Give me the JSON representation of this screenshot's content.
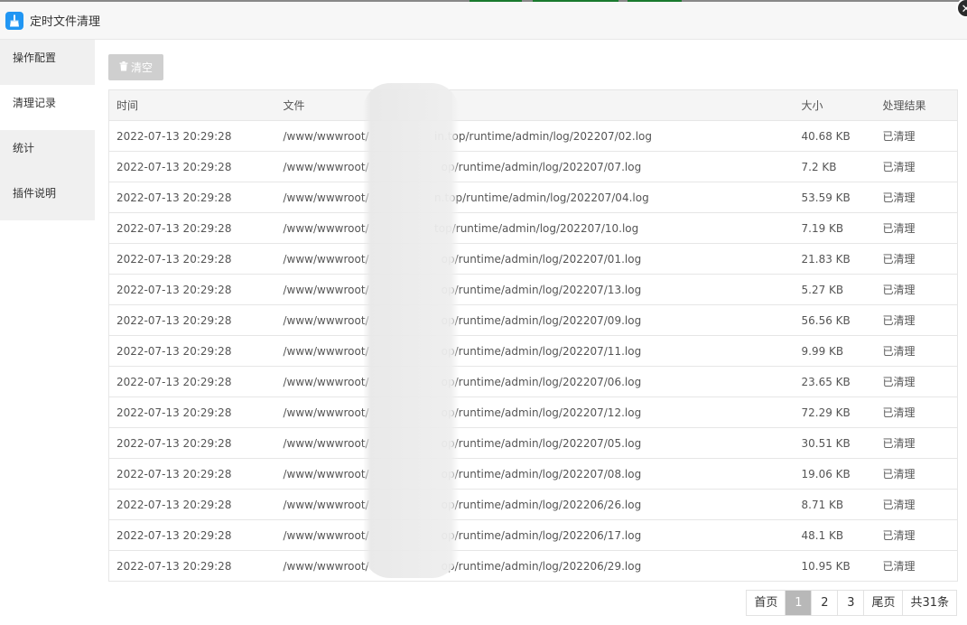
{
  "window": {
    "title": "定时文件清理",
    "close_glyph": "✕",
    "icon": "broom-icon",
    "icon_color": "#2196f3"
  },
  "sidebar": {
    "items": [
      {
        "label": "操作配置",
        "active": false
      },
      {
        "label": "清理记录",
        "active": true
      },
      {
        "label": "统计",
        "active": false
      },
      {
        "label": "插件说明",
        "active": false
      }
    ]
  },
  "toolbar": {
    "clear_label": "清空",
    "clear_icon": "trash-icon"
  },
  "table": {
    "headers": {
      "time": "时间",
      "file": "文件",
      "size": "大小",
      "result": "处理结果"
    },
    "rows": [
      {
        "time": "2022-07-13 20:29:28",
        "file": "/www/wwwroot/                   in.top/runtime/admin/log/202207/02.log",
        "size": "40.68 KB",
        "result": "已清理"
      },
      {
        "time": "2022-07-13 20:29:28",
        "file": "/www/wwwroot/                     op/runtime/admin/log/202207/07.log",
        "size": "7.2 KB",
        "result": "已清理"
      },
      {
        "time": "2022-07-13 20:29:28",
        "file": "/www/wwwroot/                   n.top/runtime/admin/log/202207/04.log",
        "size": "53.59 KB",
        "result": "已清理"
      },
      {
        "time": "2022-07-13 20:29:28",
        "file": "/www/wwwroot/                   top/runtime/admin/log/202207/10.log",
        "size": "7.19 KB",
        "result": "已清理"
      },
      {
        "time": "2022-07-13 20:29:28",
        "file": "/www/wwwroot/                     op/runtime/admin/log/202207/01.log",
        "size": "21.83 KB",
        "result": "已清理"
      },
      {
        "time": "2022-07-13 20:29:28",
        "file": "/www/wwwroot/                     op/runtime/admin/log/202207/13.log",
        "size": "5.27 KB",
        "result": "已清理"
      },
      {
        "time": "2022-07-13 20:29:28",
        "file": "/www/wwwroot/                     op/runtime/admin/log/202207/09.log",
        "size": "56.56 KB",
        "result": "已清理"
      },
      {
        "time": "2022-07-13 20:29:28",
        "file": "/www/wwwroot/                     op/runtime/admin/log/202207/11.log",
        "size": "9.99 KB",
        "result": "已清理"
      },
      {
        "time": "2022-07-13 20:29:28",
        "file": "/www/wwwroot/                     op/runtime/admin/log/202207/06.log",
        "size": "23.65 KB",
        "result": "已清理"
      },
      {
        "time": "2022-07-13 20:29:28",
        "file": "/www/wwwroot/                     op/runtime/admin/log/202207/12.log",
        "size": "72.29 KB",
        "result": "已清理"
      },
      {
        "time": "2022-07-13 20:29:28",
        "file": "/www/wwwroot/                     op/runtime/admin/log/202207/05.log",
        "size": "30.51 KB",
        "result": "已清理"
      },
      {
        "time": "2022-07-13 20:29:28",
        "file": "/www/wwwroot/                     op/runtime/admin/log/202207/08.log",
        "size": "19.06 KB",
        "result": "已清理"
      },
      {
        "time": "2022-07-13 20:29:28",
        "file": "/www/wwwroot/                     op/runtime/admin/log/202206/26.log",
        "size": "8.71 KB",
        "result": "已清理"
      },
      {
        "time": "2022-07-13 20:29:28",
        "file": "/www/wwwroot/                     op/runtime/admin/log/202206/17.log",
        "size": "48.1 KB",
        "result": "已清理"
      },
      {
        "time": "2022-07-13 20:29:28",
        "file": "/www/wwwroot/                     op/runtime/admin/log/202206/29.log",
        "size": "10.95 KB",
        "result": "已清理"
      }
    ]
  },
  "pagination": {
    "first": "首页",
    "pages": [
      {
        "label": "1",
        "current": true
      },
      {
        "label": "2",
        "current": false
      },
      {
        "label": "3",
        "current": false
      }
    ],
    "last": "尾页",
    "total": "共31条"
  },
  "colors": {
    "accent": "#2196f3",
    "disabled_button": "#cfcfcf",
    "current_page": "#b8b8b8"
  }
}
